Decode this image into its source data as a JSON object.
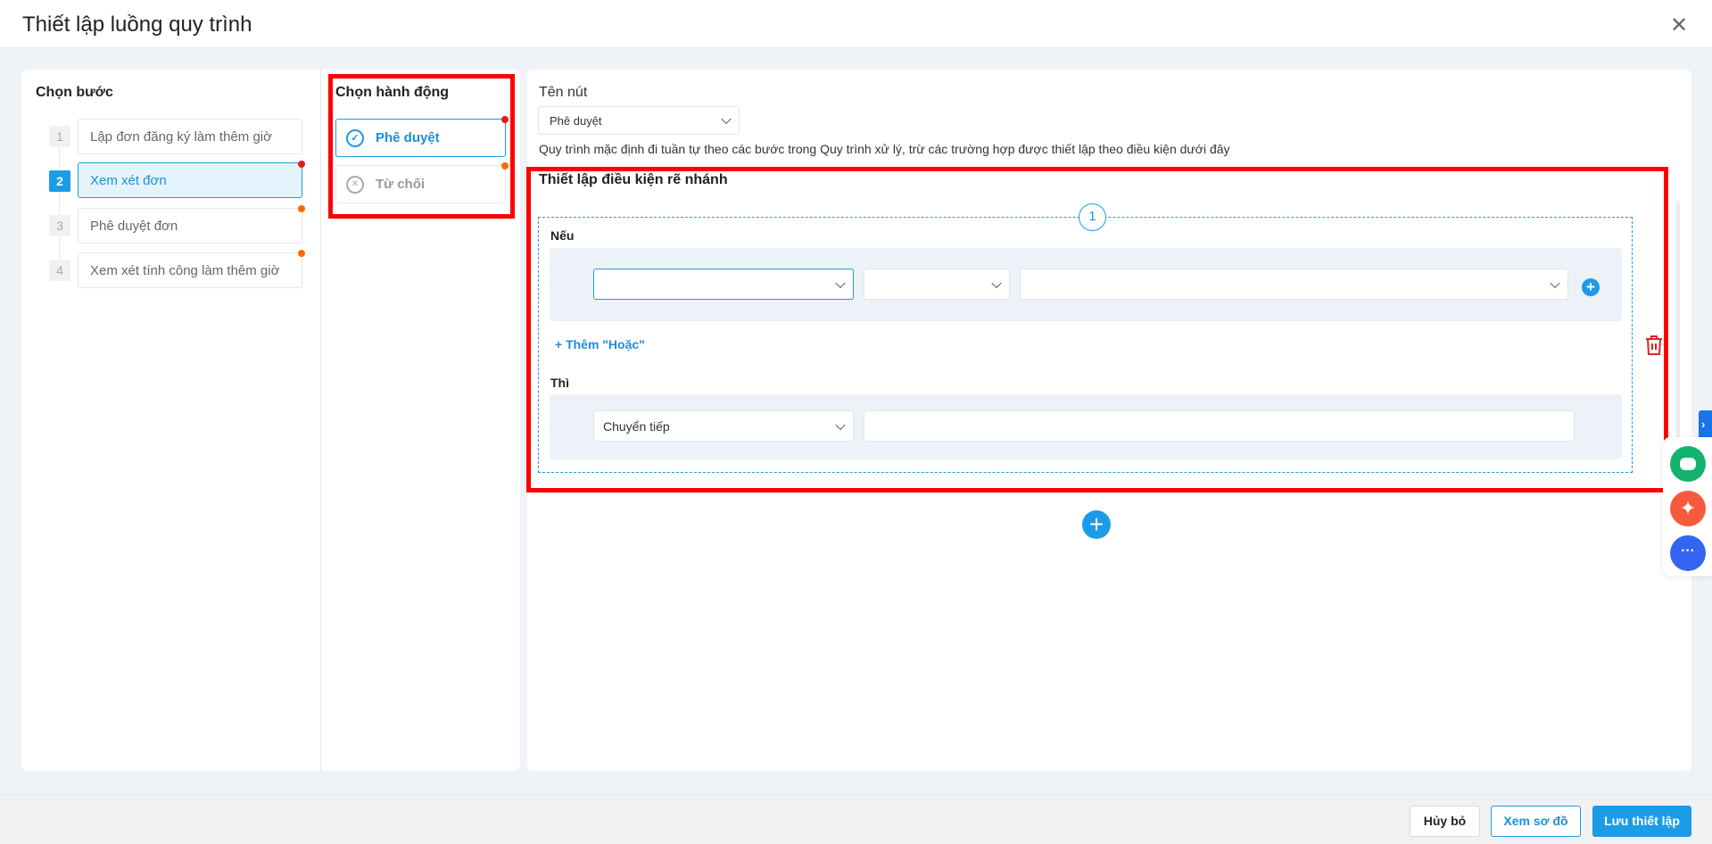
{
  "header": {
    "title": "Thiết lập luồng quy trình",
    "close": "✕"
  },
  "steps": {
    "title": "Chọn bước",
    "items": [
      {
        "num": "1",
        "label": "Lập đơn đăng ký làm thêm giờ",
        "active": false
      },
      {
        "num": "2",
        "label": "Xem xét đơn",
        "active": true
      },
      {
        "num": "3",
        "label": "Phê duyệt đơn",
        "active": false
      },
      {
        "num": "4",
        "label": "Xem xét tính công làm thêm giờ",
        "active": false
      }
    ]
  },
  "actions": {
    "title": "Chọn hành động",
    "items": [
      {
        "label": "Phê duyệt"
      },
      {
        "label": "Từ chối"
      }
    ]
  },
  "config": {
    "button_name_label": "Tên nút",
    "button_name_value": "Phê duyệt",
    "description": "Quy trình mặc định đi tuần tự theo các bước trong Quy trình xử lý, trừ các trường hợp được thiết lập theo điều kiện dưới đây",
    "branch_title": "Thiết lập điều kiện rẽ nhánh",
    "branch_index": "1",
    "if_label": "Nếu",
    "add_or": "+  Thêm \"Hoặc\"",
    "then_label": "Thì",
    "then_action": "Chuyển tiếp"
  },
  "footer": {
    "cancel": "Hủy bỏ",
    "view_diagram": "Xem sơ đồ",
    "save": "Lưu thiết lập"
  },
  "colors": {
    "accent": "#1c9be6",
    "highlight": "#ff0000",
    "danger": "#e02424"
  }
}
